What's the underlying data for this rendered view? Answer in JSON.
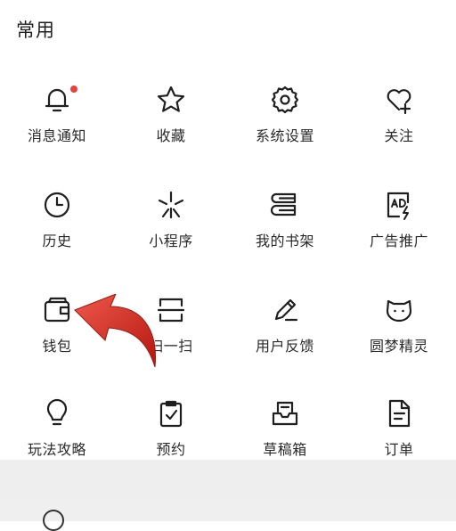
{
  "section": {
    "title": "常用"
  },
  "accent_color": "#e8413a",
  "grid": {
    "items": [
      {
        "label": "消息通知",
        "icon": "bell-icon",
        "badge": true
      },
      {
        "label": "收藏",
        "icon": "star-icon"
      },
      {
        "label": "系统设置",
        "icon": "gear-icon"
      },
      {
        "label": "关注",
        "icon": "heart-plus-icon"
      },
      {
        "label": "历史",
        "icon": "clock-icon"
      },
      {
        "label": "小程序",
        "icon": "mini-program-icon"
      },
      {
        "label": "我的书架",
        "icon": "bookshelf-icon"
      },
      {
        "label": "广告推广",
        "icon": "ad-icon"
      },
      {
        "label": "钱包",
        "icon": "wallet-icon"
      },
      {
        "label": "扫一扫",
        "icon": "scan-icon"
      },
      {
        "label": "用户反馈",
        "icon": "feedback-pen-icon"
      },
      {
        "label": "圆梦精灵",
        "icon": "sprite-cat-icon"
      },
      {
        "label": "玩法攻略",
        "icon": "lightbulb-icon"
      },
      {
        "label": "预约",
        "icon": "clipboard-check-icon"
      },
      {
        "label": "草稿箱",
        "icon": "inbox-icon"
      },
      {
        "label": "订单",
        "icon": "document-icon"
      }
    ]
  }
}
